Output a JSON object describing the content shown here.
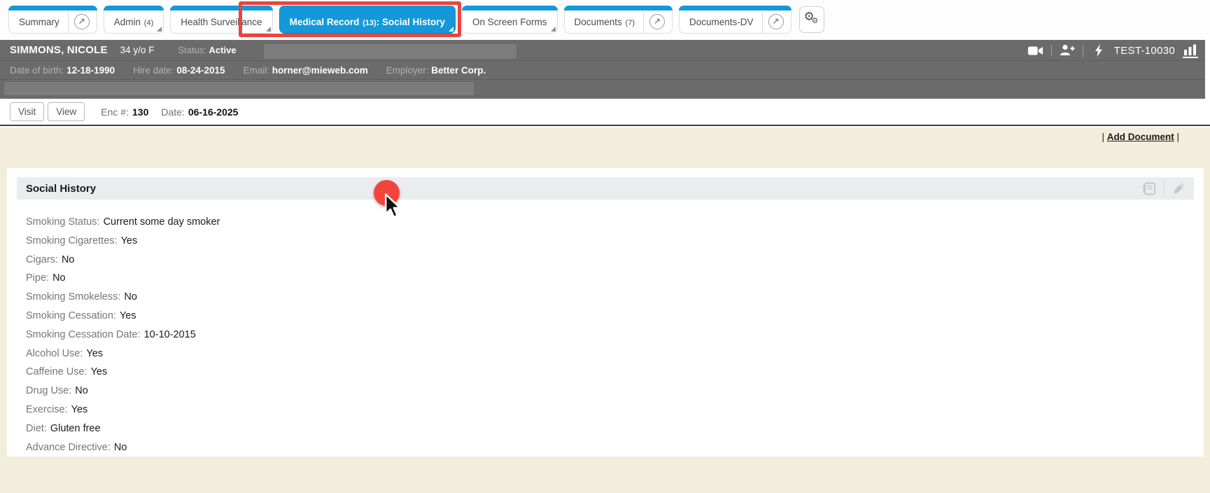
{
  "colors": {
    "accent_blue": "#1399d9",
    "annotation_red": "#e94440",
    "header_gray": "#6b6b6b",
    "redaction_gray": "#7c7c7c",
    "content_beige": "#f3eddb",
    "panel_header_gray": "#ebecf0"
  },
  "tab_bar": {
    "tabs": [
      {
        "id": "summary",
        "label": "Summary",
        "external": true
      },
      {
        "id": "admin",
        "label": "Admin",
        "count": "(4)",
        "dropdown": true
      },
      {
        "id": "health-surveillance",
        "label": "Health Surveillance",
        "dropdown": true
      },
      {
        "id": "medical-record",
        "label": "Medical Record",
        "count": "(13)",
        "separator": ":",
        "section": "Social History",
        "active": true,
        "dropdown": true
      },
      {
        "id": "on-screen-forms",
        "label": "On Screen Forms",
        "dropdown": true
      },
      {
        "id": "documents",
        "label": "Documents",
        "count": "(7)",
        "external": true
      },
      {
        "id": "documents-dv",
        "label": "Documents-DV",
        "external": true
      }
    ],
    "external_glyph": "↗",
    "gear_glyph_big": "⚙",
    "gear_glyph_small": "⚙"
  },
  "patient": {
    "name": "SIMMONS, NICOLE",
    "age_sex": "34 y/o F",
    "status_label": "Status:",
    "status_value": "Active",
    "chart_id": "TEST-10030",
    "fields": [
      {
        "label": "Date of birth:",
        "value": "12-18-1990"
      },
      {
        "label": "Hire date:",
        "value": "08-24-2015"
      },
      {
        "label": "Email:",
        "value": "horner@mieweb.com"
      },
      {
        "label": "Employer:",
        "value": "Better Corp."
      }
    ]
  },
  "encounter": {
    "visit_label": "Visit",
    "view_label": "View",
    "enc_label": "Enc #:",
    "enc_value": "130",
    "date_label": "Date:",
    "date_value": "06-16-2025"
  },
  "content": {
    "add_document_pipe_left": "| ",
    "add_document_label": "Add Document",
    "add_document_pipe_right": " |",
    "panel_title": "Social History",
    "items": [
      {
        "label": "Smoking Status:",
        "value": "Current some day smoker"
      },
      {
        "label": "Smoking Cigarettes:",
        "value": "Yes"
      },
      {
        "label": "Cigars:",
        "value": "No"
      },
      {
        "label": "Pipe:",
        "value": "No"
      },
      {
        "label": "Smoking Smokeless:",
        "value": "No"
      },
      {
        "label": "Smoking Cessation:",
        "value": "Yes"
      },
      {
        "label": "Smoking Cessation Date:",
        "value": "10-10-2015"
      },
      {
        "label": "Alcohol Use:",
        "value": "Yes"
      },
      {
        "label": "Caffeine Use:",
        "value": "Yes"
      },
      {
        "label": "Drug Use:",
        "value": "No"
      },
      {
        "label": "Exercise:",
        "value": "Yes"
      },
      {
        "label": "Diet:",
        "value": "Gluten free"
      },
      {
        "label": "Advance Directive:",
        "value": "No"
      }
    ]
  }
}
